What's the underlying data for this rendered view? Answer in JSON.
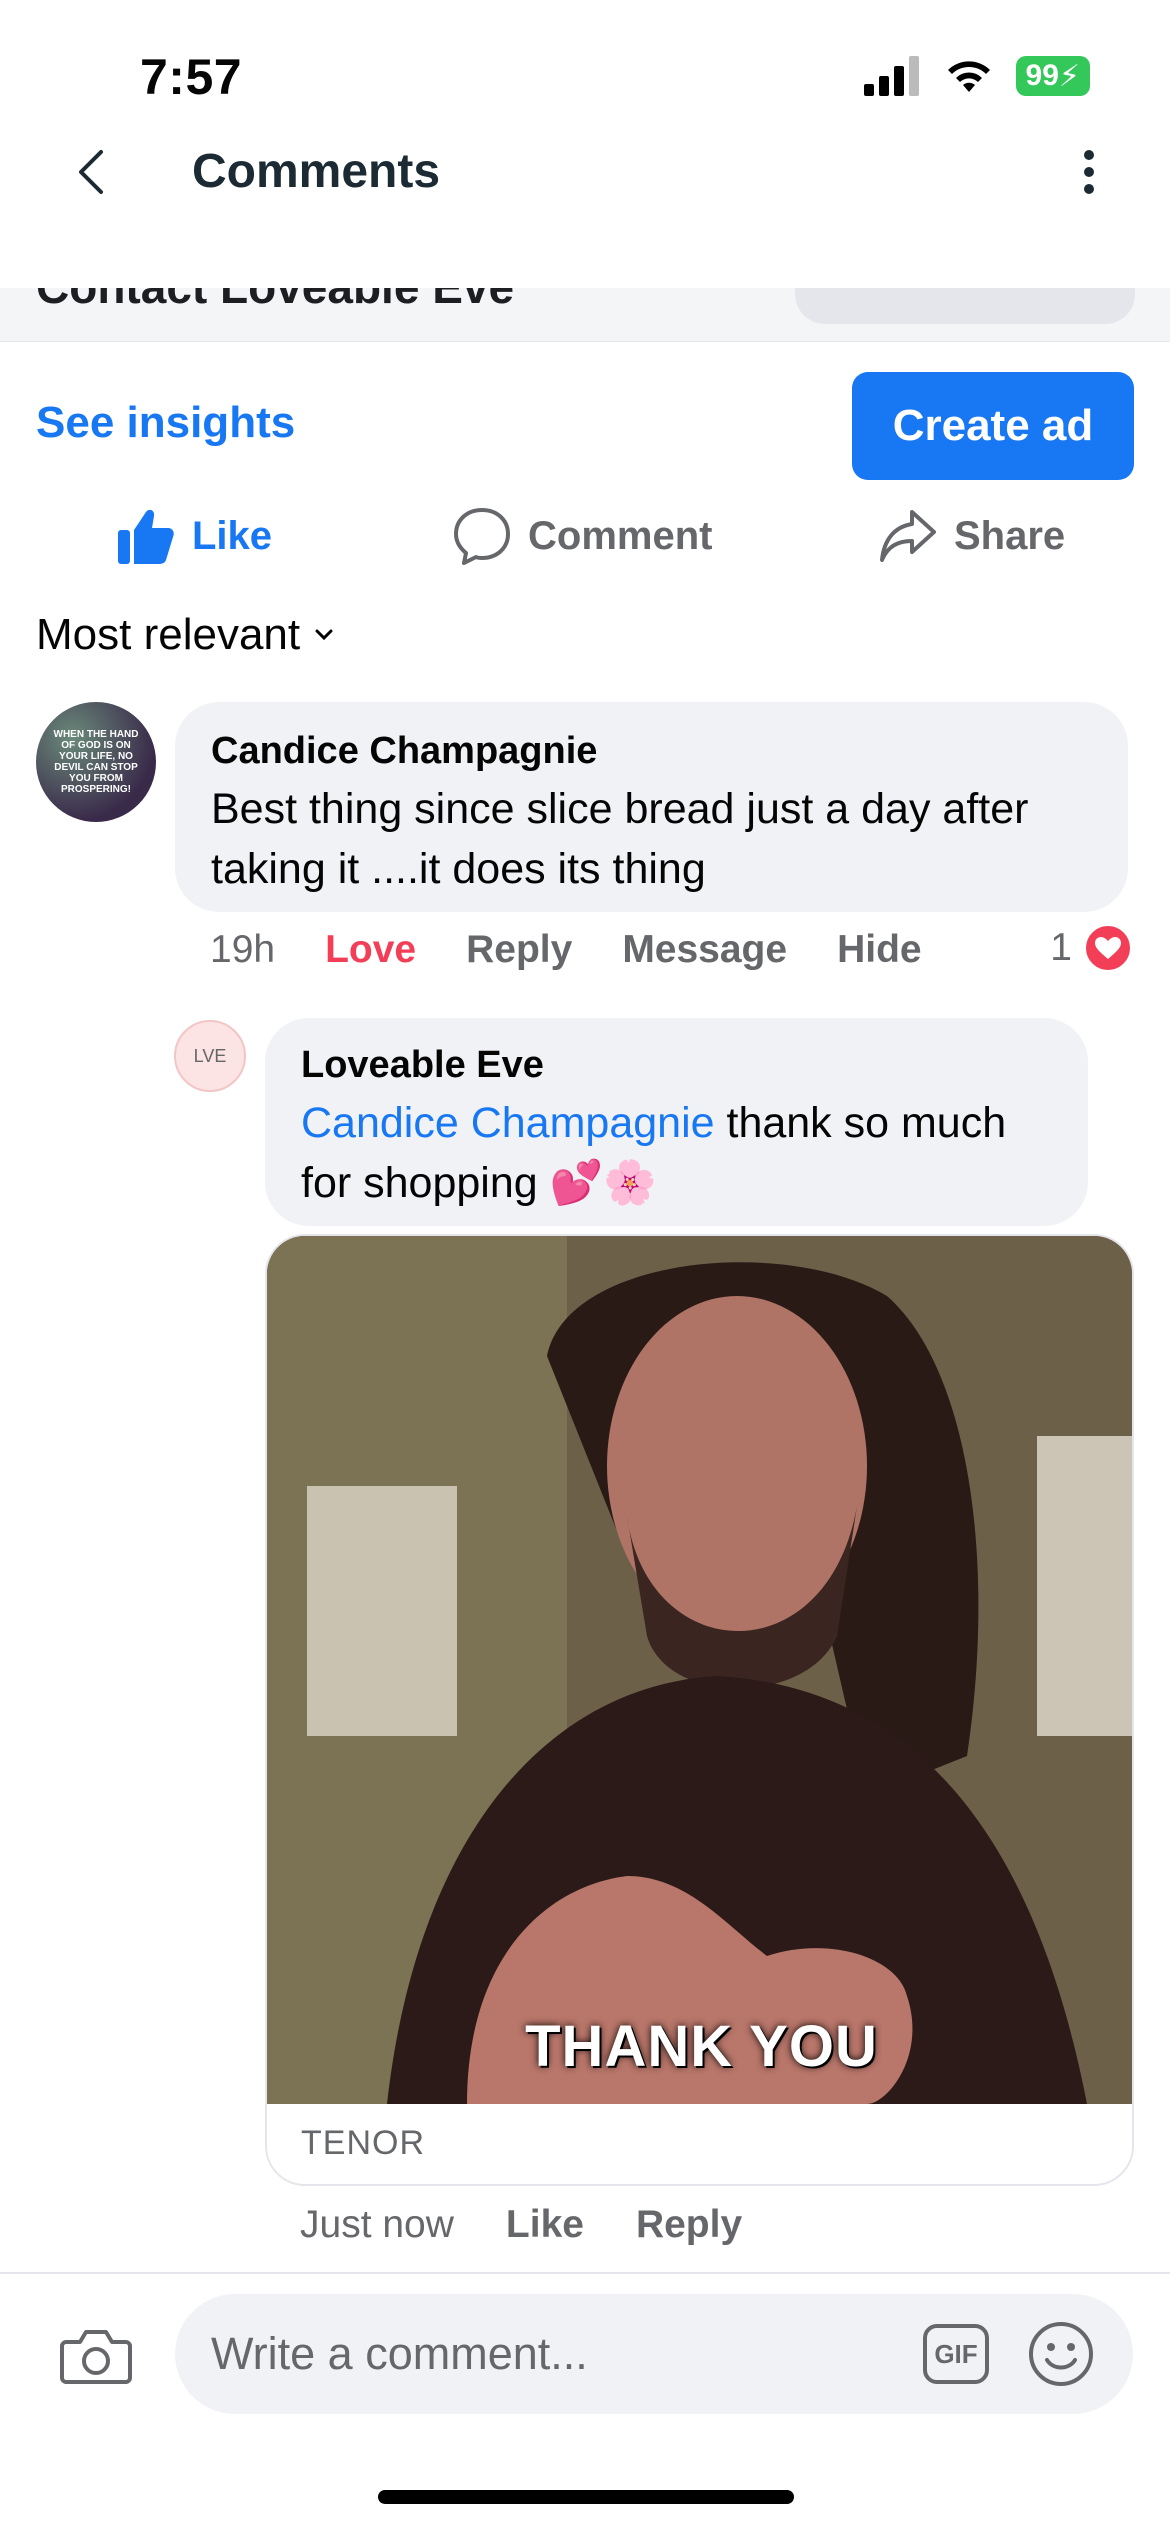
{
  "status_bar": {
    "time": "7:57",
    "battery": "99"
  },
  "header": {
    "title": "Comments"
  },
  "page_banner": {
    "clipped_title": "Contact Loveable Eve"
  },
  "insights": {
    "link": "See insights",
    "create_ad": "Create ad"
  },
  "actions": {
    "like": "Like",
    "comment": "Comment",
    "share": "Share"
  },
  "sort": {
    "label": "Most relevant"
  },
  "comments": [
    {
      "author": "Candice Champagnie",
      "avatar_text": "WHEN THE HAND OF GOD IS ON YOUR LIFE, NO DEVIL CAN STOP YOU FROM PROSPERING!",
      "text": "Best thing since slice bread just a day after taking it ....it does its thing",
      "time": "19h",
      "reaction_label": "Love",
      "reply": "Reply",
      "message": "Message",
      "hide": "Hide",
      "reaction_count": "1"
    }
  ],
  "reply": {
    "author": "Loveable Eve",
    "avatar_text": "LVE",
    "mention": "Candice Champagnie",
    "text": " thank so much for shopping 💕🌸",
    "gif_caption": "THANK YOU",
    "gif_source": "TENOR",
    "time": "Just now",
    "like": "Like",
    "reply": "Reply"
  },
  "composer": {
    "placeholder": "Write a comment...",
    "gif_label": "GIF"
  },
  "colors": {
    "accent": "#1877f2",
    "love": "#f33e58",
    "muted": "#65676b",
    "bubble": "#f0f2f5"
  }
}
